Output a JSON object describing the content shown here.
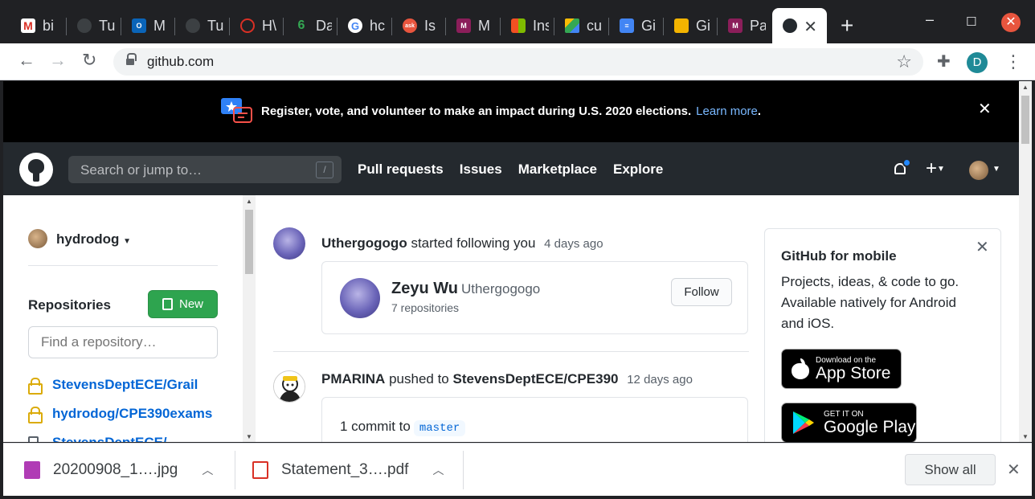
{
  "browser": {
    "tabs": [
      {
        "label": "bi",
        "icon": "gmail-icon",
        "color": "#d93025"
      },
      {
        "label": "Tu",
        "icon": "globe-icon",
        "color": "#5f6368"
      },
      {
        "label": "M",
        "icon": "outlook-icon",
        "color": "#0a64b8"
      },
      {
        "label": "Tu",
        "icon": "globe-icon",
        "color": "#5f6368"
      },
      {
        "label": "H\\",
        "icon": "helm-icon",
        "color": "#d93025"
      },
      {
        "label": "Da",
        "icon": "leaf-icon",
        "color": "#34a853"
      },
      {
        "label": "hc",
        "icon": "google-icon",
        "color": "#4285f4"
      },
      {
        "label": "Is",
        "icon": "ask-icon",
        "color": "#e8553e"
      },
      {
        "label": "M",
        "icon": "monogram-m-icon",
        "color": "#8b1e5a"
      },
      {
        "label": "Ins",
        "icon": "microsoft-icon",
        "color": "#f25022"
      },
      {
        "label": "cu",
        "icon": "google-drive-icon",
        "color": "#fbbc04"
      },
      {
        "label": "Gi",
        "icon": "google-docs-icon",
        "color": "#4285f4"
      },
      {
        "label": "Gi",
        "icon": "google-slides-icon",
        "color": "#f4b400"
      },
      {
        "label": "Pa",
        "icon": "monogram-m-icon",
        "color": "#8b1e5a"
      },
      {
        "label": "",
        "icon": "github-icon",
        "color": "#24292e",
        "active": true
      }
    ],
    "url": "github.com",
    "profile_initial": "D"
  },
  "banner": {
    "message": "Register, vote, and volunteer to make an impact during U.S. 2020 elections.",
    "link": "Learn more",
    "trail": "."
  },
  "header": {
    "search_placeholder": "Search or jump to…",
    "search_shortcut": "/",
    "nav": [
      "Pull requests",
      "Issues",
      "Marketplace",
      "Explore"
    ]
  },
  "sidebar": {
    "username": "hydrodog",
    "repos_heading": "Repositories",
    "new_label": "New",
    "filter_placeholder": "Find a repository…",
    "repos": [
      {
        "name": "StevensDeptECE/Grail",
        "private": true
      },
      {
        "name": "hydrodog/CPE390exams",
        "private": true
      },
      {
        "name": "StevensDeptECE/",
        "private": false
      }
    ]
  },
  "feed": {
    "events": [
      {
        "actor": "Uthergogogo",
        "action": "started following you",
        "time": "4 days ago",
        "card": {
          "name": "Zeyu Wu",
          "login": "Uthergogogo",
          "repos": "7 repositories",
          "button": "Follow"
        }
      },
      {
        "actor": "PMARINA",
        "action": "pushed to",
        "target": "StevensDeptECE/CPE390",
        "time": "12 days ago",
        "card": {
          "commits": "1 commit to",
          "branch": "master"
        }
      }
    ]
  },
  "promo": {
    "title": "GitHub for mobile",
    "body": "Projects, ideas, & code to go. Available natively for Android and iOS.",
    "appstore_small": "Download on the",
    "appstore_big": "App Store",
    "gplay_small": "GET IT ON",
    "gplay_big": "Google Play"
  },
  "downloads": {
    "items": [
      {
        "name": "20200908_1….jpg",
        "icon": "image-file-icon",
        "color": "#b03cb5"
      },
      {
        "name": "Statement_3….pdf",
        "icon": "pdf-file-icon",
        "color": "#d93025"
      }
    ],
    "show_all": "Show all"
  }
}
